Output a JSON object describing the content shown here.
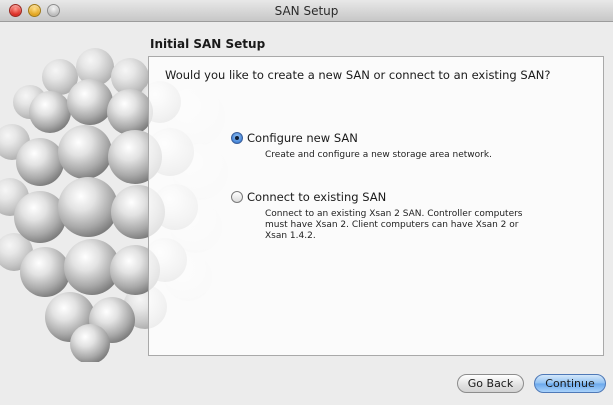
{
  "window": {
    "title": "SAN Setup"
  },
  "page": {
    "heading": "Initial SAN Setup",
    "question": "Would you like to create a new SAN or connect to an existing SAN?"
  },
  "options": [
    {
      "label": "Configure new SAN",
      "description": "Create and configure a new storage area network.",
      "selected": true
    },
    {
      "label": "Connect to existing SAN",
      "description": "Connect to an existing Xsan 2 SAN. Controller computers must have Xsan 2. Client computers can have Xsan 2 or Xsan 1.4.2.",
      "selected": false
    }
  ],
  "buttons": {
    "back": "Go Back",
    "continue": "Continue"
  },
  "colors": {
    "accent": "#6aa8ec",
    "window_background": "#ececec"
  }
}
